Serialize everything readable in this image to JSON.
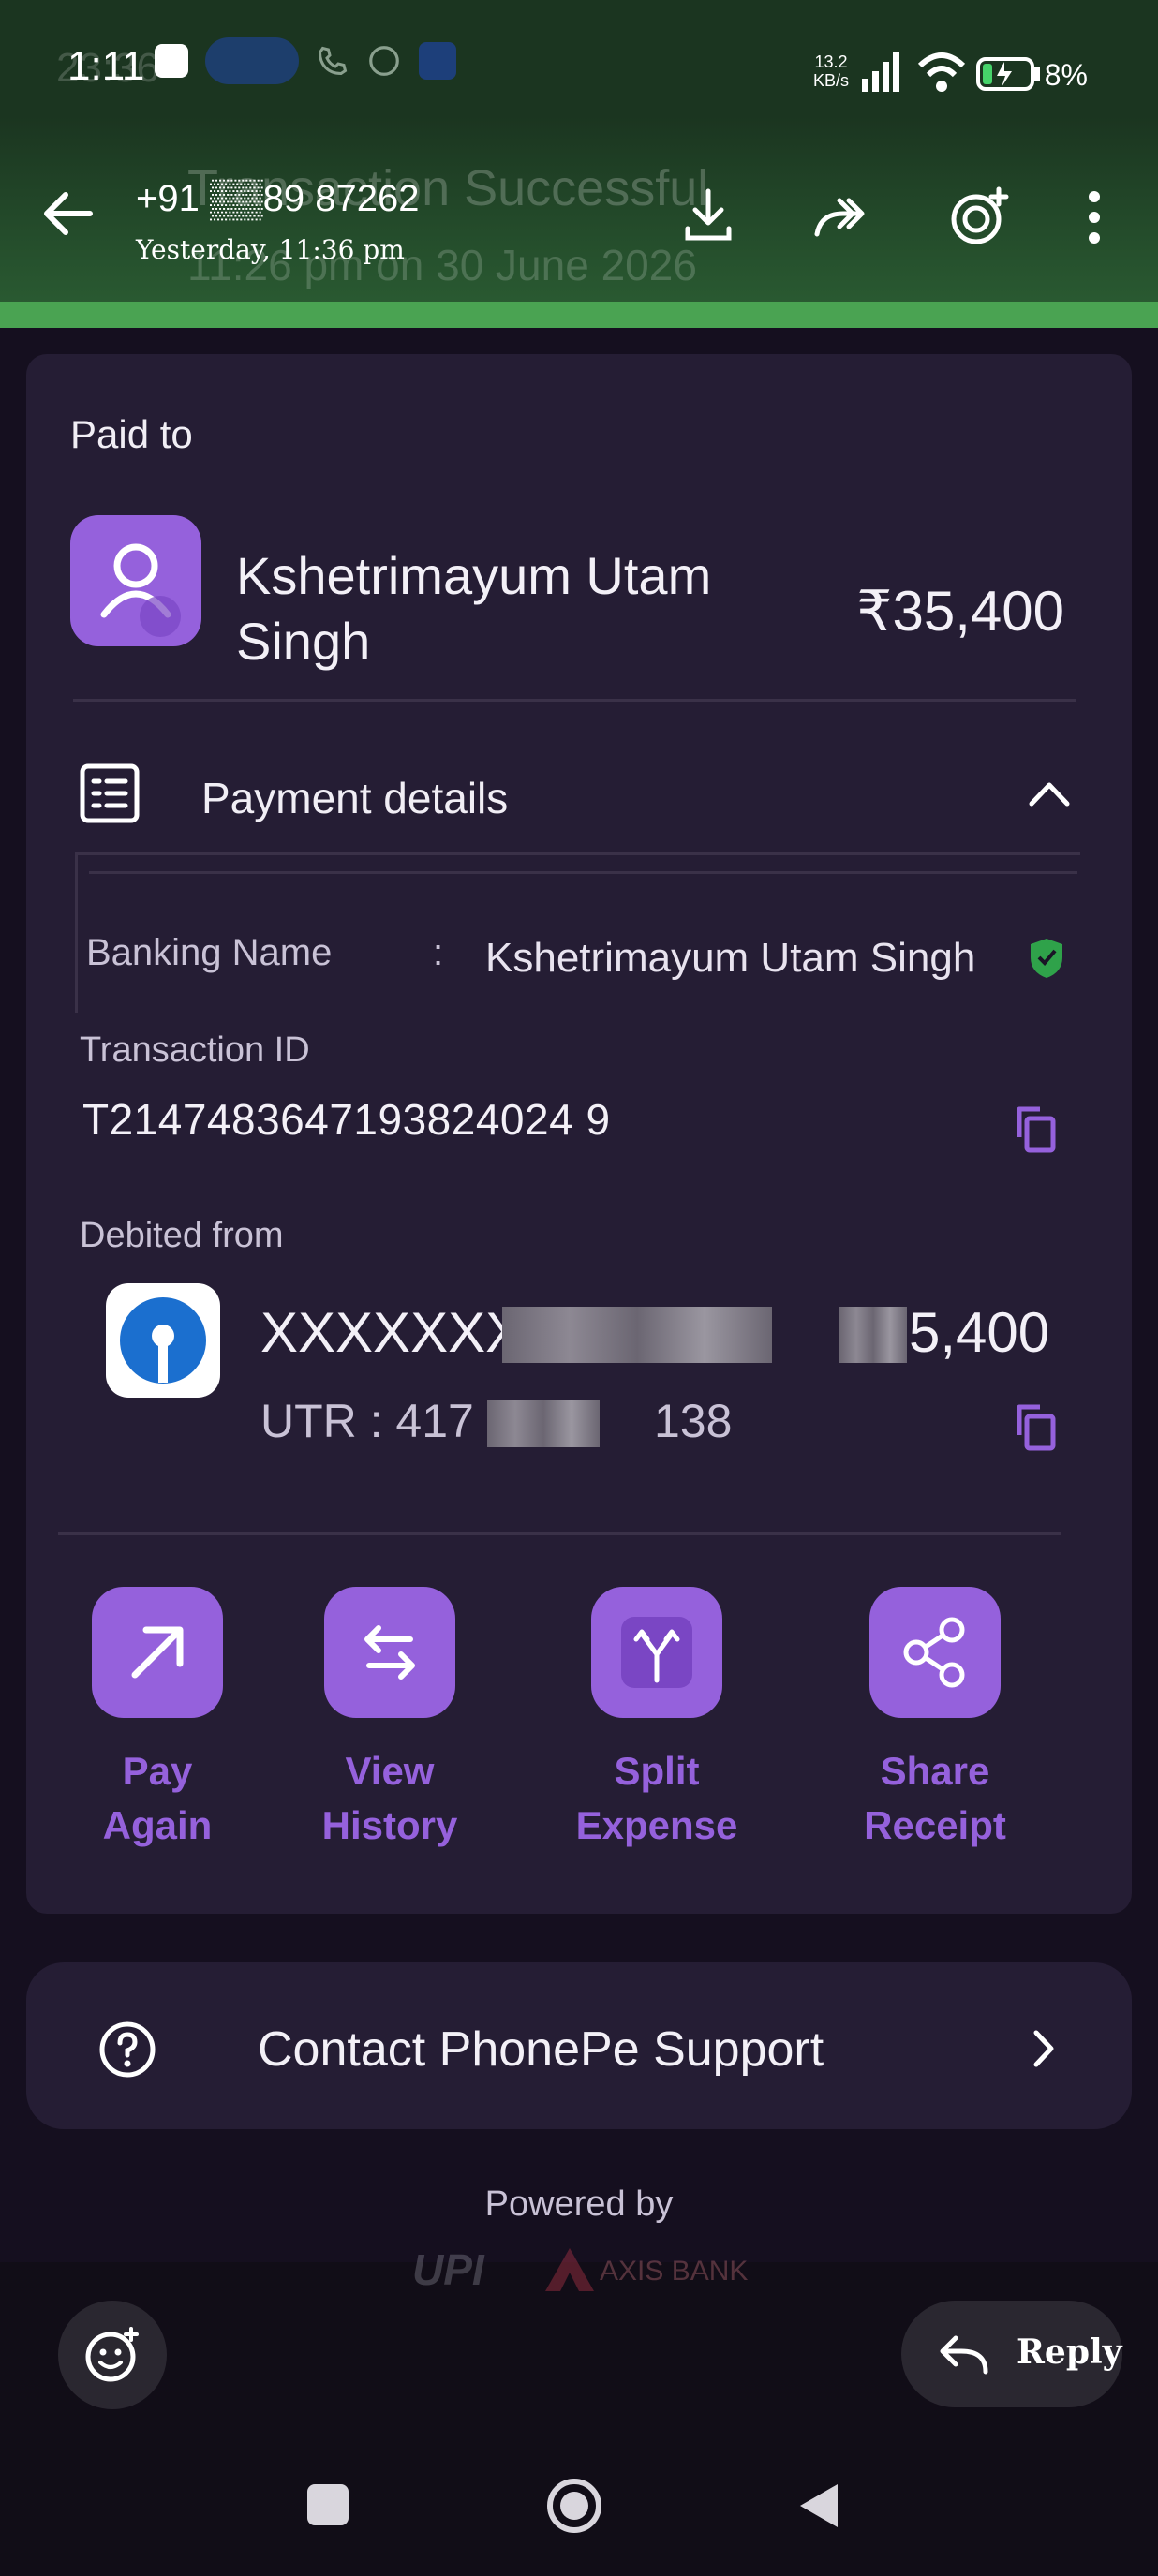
{
  "status_bar": {
    "time": "1:11",
    "ghost_time": "23:36",
    "net_speed_value": "13.2",
    "net_speed_unit": "KB/s",
    "battery": "8%"
  },
  "header": {
    "sender": "+91 ▒▒89 87262",
    "timestamp": "Yesterday, 11:36 pm",
    "ghost_title": "Transaction Successful",
    "ghost_subtitle": "11:26 pm on 30 June 2026"
  },
  "payment": {
    "paid_to_label": "Paid to",
    "payee_name": "Kshetrimayum Utam Singh",
    "amount": "₹35,400",
    "details_label": "Payment details",
    "banking_name_label": "Banking Name",
    "colon": ":",
    "banking_name_value": "Kshetrimayum Utam Singh",
    "transaction_id_label": "Transaction ID",
    "transaction_id": "T2147483647193824024 9",
    "debited_from_label": "Debited from",
    "account_prefix": "XXXXXXX",
    "account_amount": "5,400",
    "utr_prefix": "UTR : 417",
    "utr_suffix": "138"
  },
  "actions": [
    {
      "line1": "Pay",
      "line2": "Again"
    },
    {
      "line1": "View",
      "line2": "History"
    },
    {
      "line1": "Split",
      "line2": "Expense"
    },
    {
      "line1": "Share",
      "line2": "Receipt"
    }
  ],
  "support": {
    "label": "Contact PhonePe Support"
  },
  "footer": {
    "powered_by": "Powered by",
    "upi": "UPI",
    "axis_bank": "AXIS BANK"
  },
  "bottom": {
    "reply_label": "Reply"
  },
  "colors": {
    "accent": "#9561dc",
    "card": "#251d34",
    "header_green": "#2a5b32"
  }
}
